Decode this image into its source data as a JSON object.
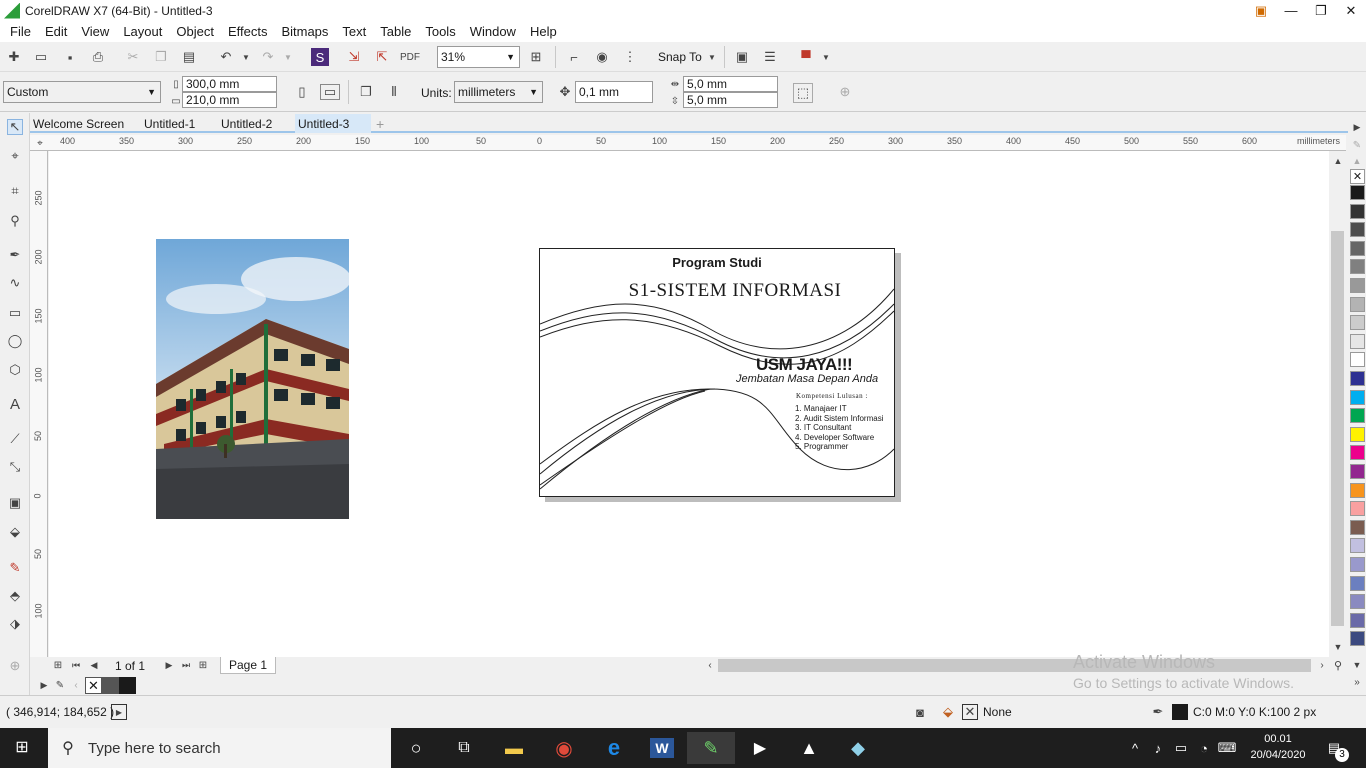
{
  "window": {
    "title": "CorelDRAW X7 (64-Bit) - Untitled-3",
    "min": "—",
    "max": "❐",
    "close": "✕"
  },
  "menu": [
    "File",
    "Edit",
    "View",
    "Layout",
    "Object",
    "Effects",
    "Bitmaps",
    "Text",
    "Table",
    "Tools",
    "Window",
    "Help"
  ],
  "toolbar": {
    "zoom": "31%",
    "snap_to": "Snap To"
  },
  "property_bar": {
    "page_size": "Custom",
    "width": "300,0 mm",
    "height": "210,0 mm",
    "units_label": "Units:",
    "units": "millimeters",
    "nudge": "0,1 mm",
    "dup_x": "5,0 mm",
    "dup_y": "5,0 mm"
  },
  "tabs": [
    "Welcome Screen",
    "Untitled-1",
    "Untitled-2",
    "Untitled-3"
  ],
  "ruler": {
    "h_labels": [
      "400",
      "350",
      "300",
      "250",
      "200",
      "150",
      "100",
      "50",
      "0",
      "50",
      "100",
      "150",
      "200",
      "250",
      "300",
      "350",
      "400",
      "450",
      "500",
      "550",
      "600"
    ],
    "unit": "millimeters",
    "v_labels": [
      "250",
      "200",
      "150",
      "100",
      "50",
      "0",
      "50",
      "100"
    ]
  },
  "card": {
    "heading": "Program Studi",
    "program": "S1-SISTEM INFORMASI",
    "slogan": "USM JAYA!!!",
    "tagline": "Jembatan Masa Depan Anda",
    "competence_title": "Kompetensi Lulusan :",
    "competencies": [
      "1. Manajaer IT",
      "2. Audit Sistem Informasi",
      "3. IT Consultant",
      "4. Developer Software",
      "5. Programmer"
    ]
  },
  "pagebar": {
    "page_count": "1 of 1",
    "page_tab": "Page 1"
  },
  "watermark": {
    "line1": "Activate Windows",
    "line2": "Go to Settings to activate Windows."
  },
  "status": {
    "coords": "( 346,914; 184,652 )",
    "fill": "None",
    "outline": "C:0 M:0 Y:0 K:100  2 px"
  },
  "taskbar": {
    "search_placeholder": "Type here to search",
    "time": "00.01",
    "date": "20/04/2020",
    "notifications": "3"
  },
  "palette_colors": [
    "#1a1a1a",
    "#333333",
    "#4d4d4d",
    "#666666",
    "#808080",
    "#999999",
    "#b3b3b3",
    "#cccccc",
    "#e6e6e6",
    "#ffffff",
    "#2e3192",
    "#00aeef",
    "#00a651",
    "#fff200",
    "#ec008c",
    "#92278f",
    "#f7941d",
    "#f9a0a0",
    "#7a5c50",
    "#c2c0e0",
    "#9999cc",
    "#6b7fbf",
    "#8a8ac0",
    "#6a6aa8",
    "#3c4a80"
  ]
}
